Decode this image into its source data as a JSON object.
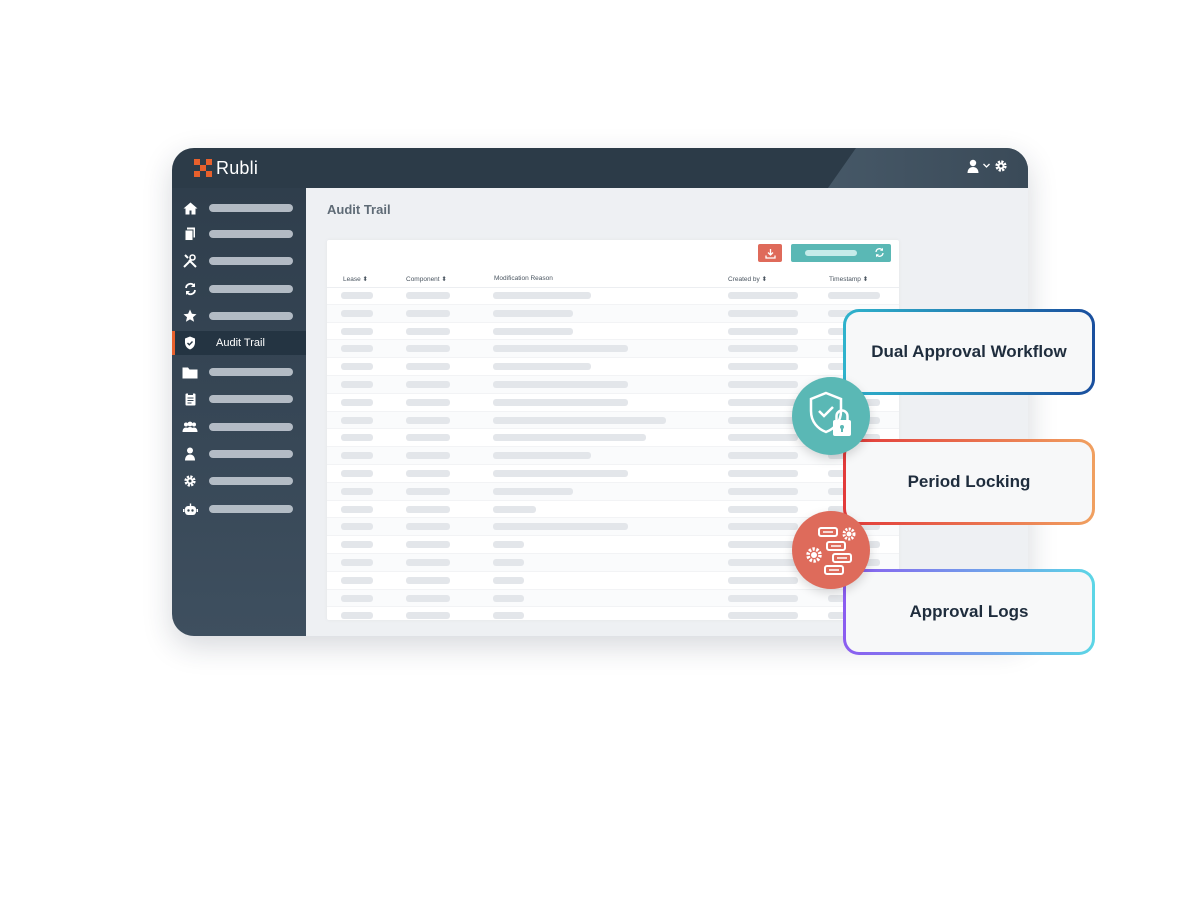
{
  "app": {
    "logo_text": "Rubli",
    "brand_color": "#e8602c"
  },
  "topbar": {
    "icons": [
      "user-icon",
      "chevron-down-icon",
      "gear-icon"
    ]
  },
  "sidebar": {
    "items": [
      {
        "icon": "home-icon",
        "label": ""
      },
      {
        "icon": "documents-icon",
        "label": ""
      },
      {
        "icon": "tools-icon",
        "label": ""
      },
      {
        "icon": "sync-icon",
        "label": ""
      },
      {
        "icon": "star-icon",
        "label": ""
      },
      {
        "icon": "shield-icon",
        "label": "Audit Trail",
        "active": true
      },
      {
        "icon": "folder-icon",
        "label": ""
      },
      {
        "icon": "clipboard-icon",
        "label": ""
      },
      {
        "icon": "users-icon",
        "label": ""
      },
      {
        "icon": "user-icon",
        "label": ""
      },
      {
        "icon": "gear-icon",
        "label": ""
      },
      {
        "icon": "robot-icon",
        "label": ""
      }
    ]
  },
  "main": {
    "page_title": "Audit Trail",
    "toolbar": {
      "download_icon": "download-icon",
      "refresh_icon": "refresh-icon",
      "download_color": "#df6a5a",
      "refresh_color": "#5ab8b5"
    },
    "table": {
      "columns": [
        "Lease",
        "Component",
        "Modification Reason",
        "Created by",
        "Timestamp"
      ],
      "sort_icon": "sort-icon"
    }
  },
  "features": [
    {
      "label": "Dual Approval Workflow",
      "icon": "shield-lock-icon",
      "accent": "#2fb3cc"
    },
    {
      "label": "Period Locking",
      "icon": "",
      "accent": "#e23a3a"
    },
    {
      "label": "Approval Logs",
      "icon": "workflow-gears-icon",
      "accent": "#8b5cf0"
    }
  ]
}
